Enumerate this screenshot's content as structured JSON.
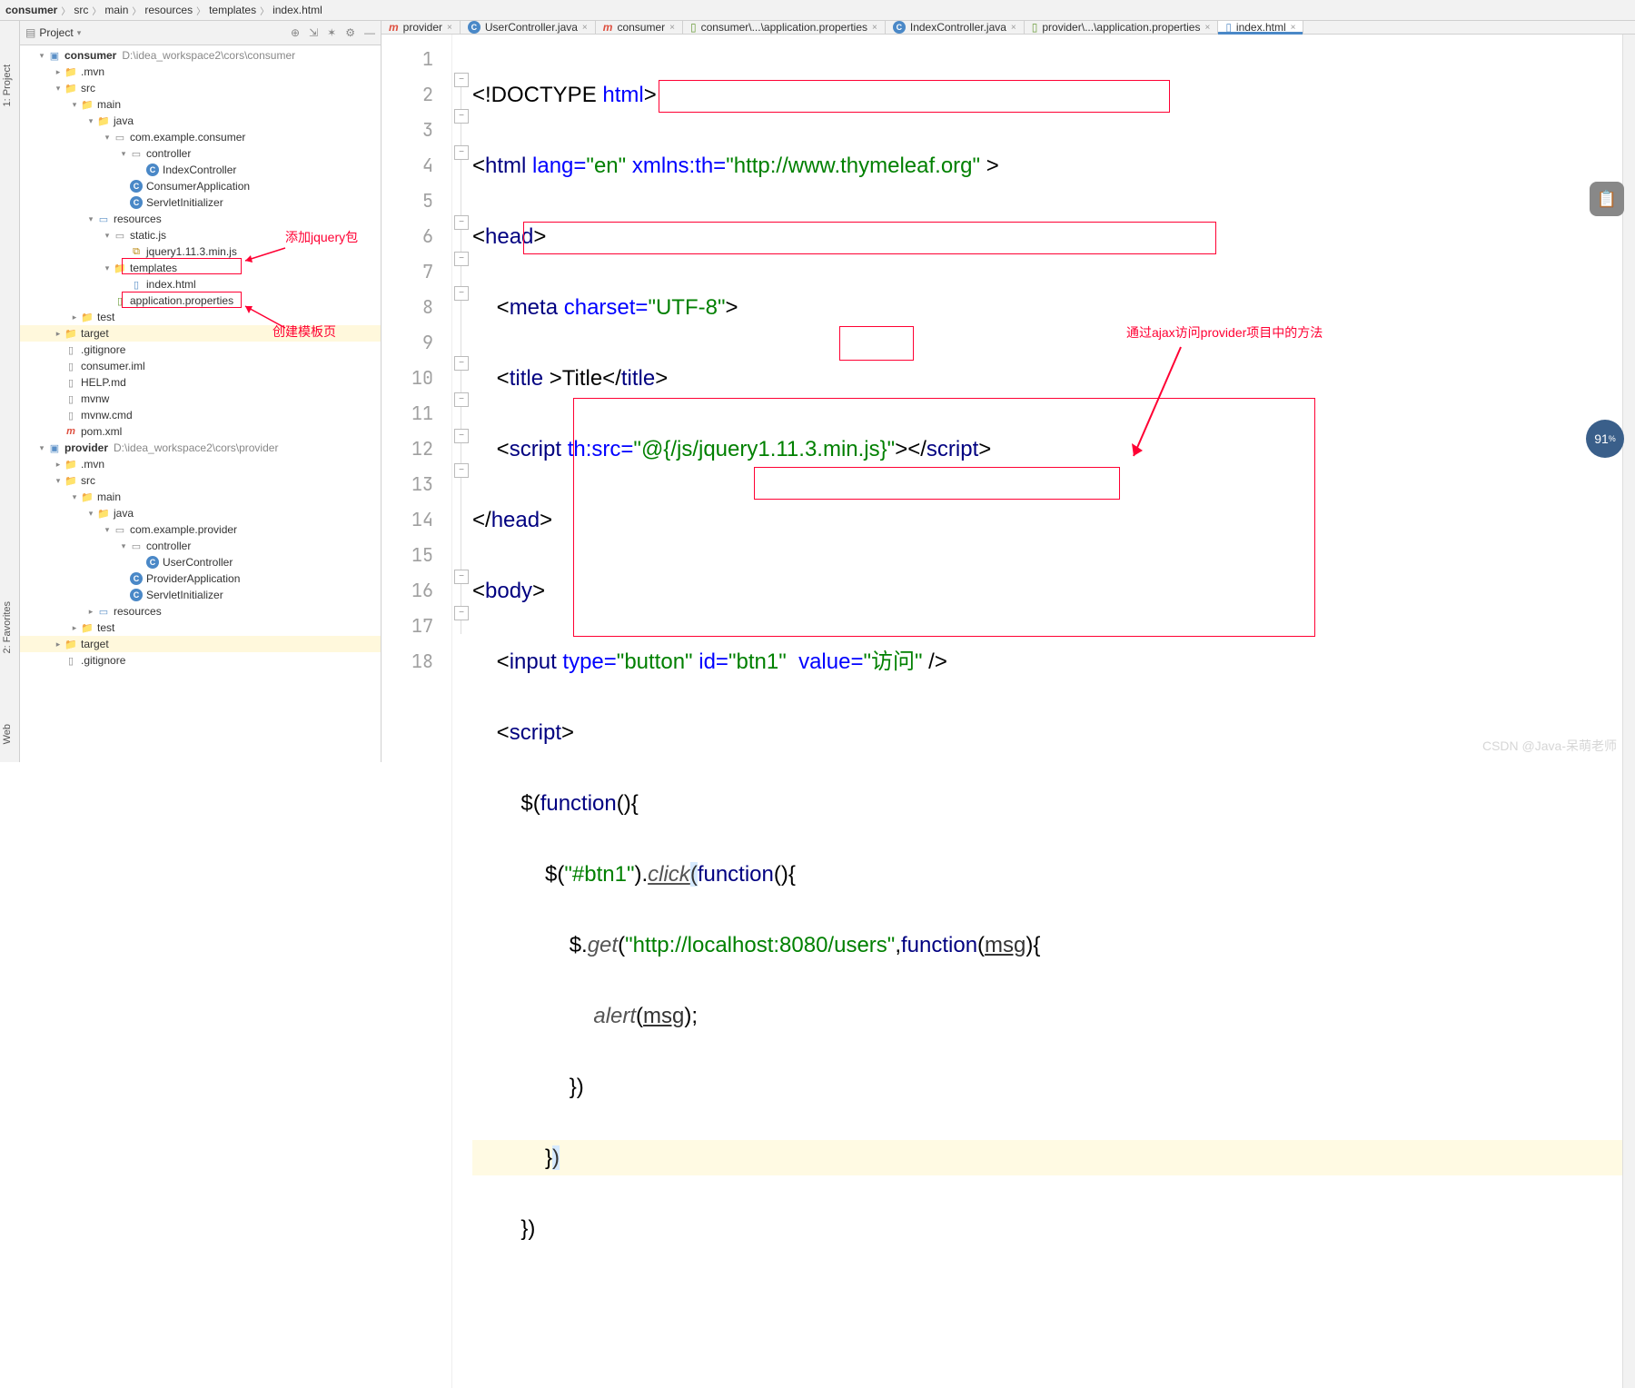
{
  "breadcrumbs": [
    "consumer",
    "src",
    "main",
    "resources",
    "templates",
    "index.html"
  ],
  "projectPanel": {
    "title": "Project"
  },
  "tree": [
    {
      "d": 0,
      "a": "v",
      "i": "mod",
      "t": "consumer",
      "g": "D:\\idea_workspace2\\cors\\consumer",
      "b": 1
    },
    {
      "d": 1,
      "a": ">",
      "i": "fld",
      "t": ".mvn"
    },
    {
      "d": 1,
      "a": "v",
      "i": "fldb",
      "t": "src"
    },
    {
      "d": 2,
      "a": "v",
      "i": "fldb",
      "t": "main"
    },
    {
      "d": 3,
      "a": "v",
      "i": "fldb",
      "t": "java"
    },
    {
      "d": 4,
      "a": "v",
      "i": "pkg",
      "t": "com.example.consumer"
    },
    {
      "d": 5,
      "a": "v",
      "i": "pkg",
      "t": "controller"
    },
    {
      "d": 6,
      "a": "",
      "i": "c",
      "t": "IndexController"
    },
    {
      "d": 5,
      "a": "",
      "i": "c",
      "t": "ConsumerApplication"
    },
    {
      "d": 5,
      "a": "",
      "i": "c",
      "t": "ServletInitializer"
    },
    {
      "d": 3,
      "a": "v",
      "i": "res",
      "t": "resources"
    },
    {
      "d": 4,
      "a": "v",
      "i": "pkg",
      "t": "static.js"
    },
    {
      "d": 5,
      "a": "",
      "i": "js",
      "t": "jquery1.11.3.min.js"
    },
    {
      "d": 4,
      "a": "v",
      "i": "fld",
      "t": "templates"
    },
    {
      "d": 5,
      "a": "",
      "i": "html",
      "t": "index.html"
    },
    {
      "d": 4,
      "a": "",
      "i": "prop",
      "t": "application.properties"
    },
    {
      "d": 2,
      "a": ">",
      "i": "fld",
      "t": "test"
    },
    {
      "d": 1,
      "a": ">",
      "i": "fldo",
      "t": "target",
      "sel": 1
    },
    {
      "d": 1,
      "a": "",
      "i": "file",
      "t": ".gitignore"
    },
    {
      "d": 1,
      "a": "",
      "i": "file",
      "t": "consumer.iml"
    },
    {
      "d": 1,
      "a": "",
      "i": "file",
      "t": "HELP.md"
    },
    {
      "d": 1,
      "a": "",
      "i": "file",
      "t": "mvnw"
    },
    {
      "d": 1,
      "a": "",
      "i": "file",
      "t": "mvnw.cmd"
    },
    {
      "d": 1,
      "a": "",
      "i": "m",
      "t": "pom.xml"
    },
    {
      "d": 0,
      "a": "v",
      "i": "mod",
      "t": "provider",
      "g": "D:\\idea_workspace2\\cors\\provider",
      "b": 1
    },
    {
      "d": 1,
      "a": ">",
      "i": "fld",
      "t": ".mvn"
    },
    {
      "d": 1,
      "a": "v",
      "i": "fldb",
      "t": "src"
    },
    {
      "d": 2,
      "a": "v",
      "i": "fldb",
      "t": "main"
    },
    {
      "d": 3,
      "a": "v",
      "i": "fldb",
      "t": "java"
    },
    {
      "d": 4,
      "a": "v",
      "i": "pkg",
      "t": "com.example.provider"
    },
    {
      "d": 5,
      "a": "v",
      "i": "pkg",
      "t": "controller"
    },
    {
      "d": 6,
      "a": "",
      "i": "c",
      "t": "UserController"
    },
    {
      "d": 5,
      "a": "",
      "i": "c",
      "t": "ProviderApplication"
    },
    {
      "d": 5,
      "a": "",
      "i": "c",
      "t": "ServletInitializer"
    },
    {
      "d": 3,
      "a": ">",
      "i": "res",
      "t": "resources"
    },
    {
      "d": 2,
      "a": ">",
      "i": "fld",
      "t": "test"
    },
    {
      "d": 1,
      "a": ">",
      "i": "fldo",
      "t": "target",
      "sel": 1
    },
    {
      "d": 1,
      "a": "",
      "i": "file",
      "t": ".gitignore"
    }
  ],
  "annotations": {
    "a1": "添加jquery包",
    "a2": "创建模板页",
    "a3": "通过ajax访问provider项目中的方法"
  },
  "tabs": [
    {
      "icon": "m",
      "label": "provider"
    },
    {
      "icon": "c",
      "label": "UserController.java"
    },
    {
      "icon": "m",
      "label": "consumer"
    },
    {
      "icon": "prop",
      "label": "consumer\\...\\application.properties"
    },
    {
      "icon": "c",
      "label": "IndexController.java"
    },
    {
      "icon": "prop",
      "label": "provider\\...\\application.properties"
    },
    {
      "icon": "html",
      "label": "index.html",
      "active": true
    }
  ],
  "codeLines": 18,
  "code": {
    "l1": "<!DOCTYPE html>",
    "l5_title": "Title",
    "l6_src": "@{/js/jquery1.11.3.min.js}",
    "l9_btn": "btn1",
    "l9_val": "访问",
    "l13_url": "http://localhost:8080/users",
    "l2_ns": "http://www.thymeleaf.org"
  },
  "leftLabels": {
    "p": "1: Project",
    "f": "2: Favorites",
    "w": "Web"
  },
  "watermark": "CSDN @Java-呆萌老师",
  "badge": "91"
}
